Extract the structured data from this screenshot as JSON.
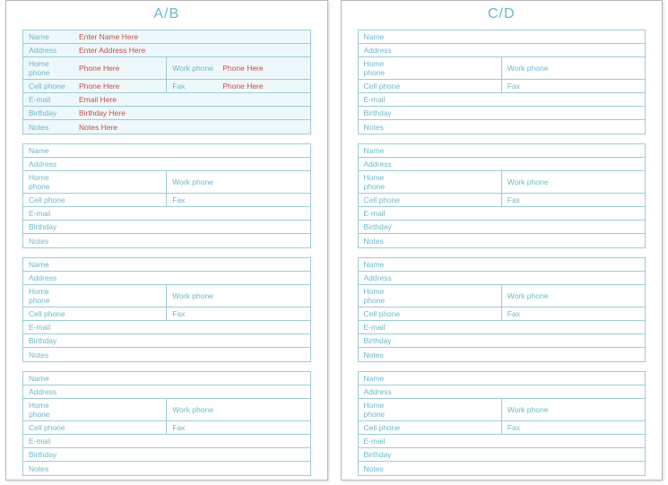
{
  "pages": [
    {
      "title": "A/B"
    },
    {
      "title": "C/D"
    }
  ],
  "labels": {
    "name": "Name",
    "address": "Address",
    "home_phone": "Home phone",
    "work_phone": "Work phone",
    "cell_phone": "Cell phone",
    "fax": "Fax",
    "email": "E-mail",
    "birthday": "Birthday",
    "notes": "Notes"
  },
  "filled_card": {
    "name": "Enter Name Here",
    "address": "Enter Address Here",
    "home_phone": "Phone Here",
    "work_phone": "Phone Here",
    "cell_phone": "Phone Here",
    "fax": "Phone Here",
    "email": "Email Here",
    "birthday": "Birthday Here",
    "notes": "Notes Here"
  }
}
